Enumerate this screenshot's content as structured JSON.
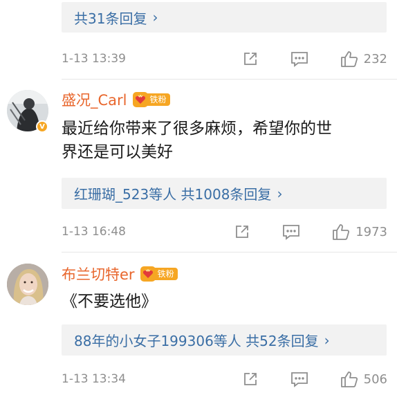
{
  "top": {
    "reply_summary": "共31条回复",
    "time": "1-13 13:39",
    "likes": "232"
  },
  "comments": [
    {
      "username": "盛况_Carl",
      "fan_badge": "铁粉",
      "verified": "V",
      "text_line1": "最近给你带来了很多麻烦，希望你的世",
      "text_line2": "界还是可以美好",
      "reply_summary": "红珊瑚_523等人 共1008条回复",
      "time": "1-13 16:48",
      "likes": "1973"
    },
    {
      "username": "布兰切特er",
      "fan_badge": "铁粉",
      "text": "《不要选他》",
      "reply_summary": "88年的小女子199306等人 共52条回复",
      "time": "1-13 13:34",
      "likes": "506"
    }
  ],
  "chevron": "›",
  "colors": {
    "username": "#e8662c",
    "link": "#3a6ea5",
    "meta": "#8e8e8e",
    "badge": "#f6a623"
  },
  "icons": [
    "share-icon",
    "comment-icon",
    "like-icon",
    "chevron-right-icon",
    "crown-heart-icon"
  ]
}
